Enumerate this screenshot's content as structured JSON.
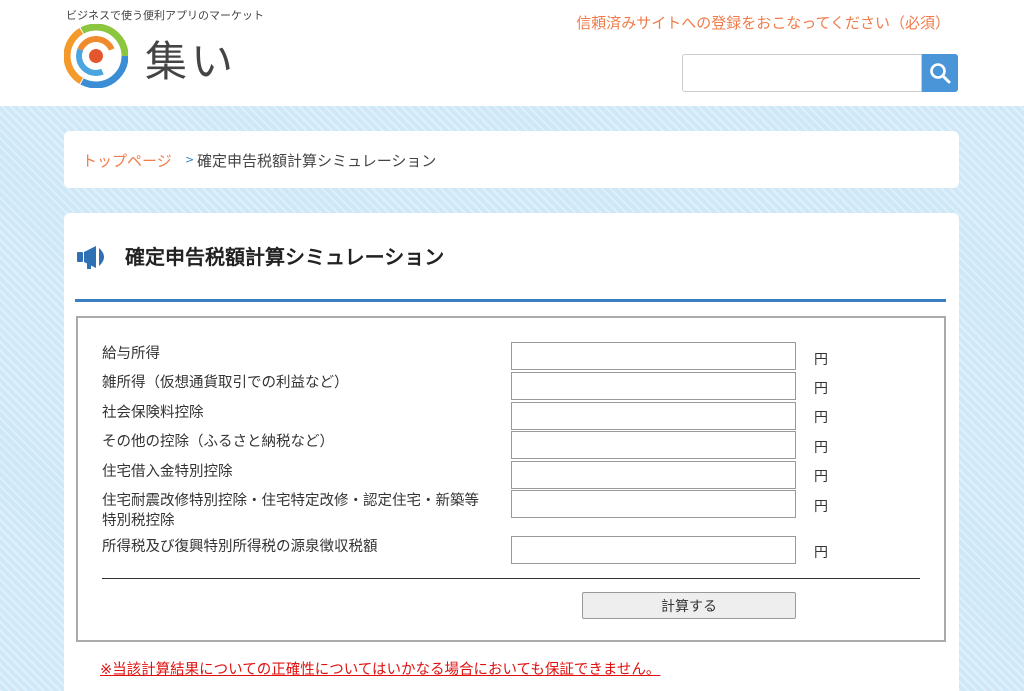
{
  "header": {
    "tagline": "ビジネスで使う便利アプリのマーケット",
    "logo_text": "集い",
    "notice_link": "信頼済みサイトへの登録をおこなってください（必須）",
    "search": {
      "value": "",
      "placeholder": ""
    }
  },
  "breadcrumb": {
    "home": "トップページ",
    "separator": ">",
    "current": "確定申告税額計算シミュレーション"
  },
  "main": {
    "title": "確定申告税額計算シミュレーション",
    "form": {
      "rows": [
        {
          "label": "給与所得",
          "value": "",
          "unit": "円"
        },
        {
          "label": "雑所得（仮想通貨取引での利益など）",
          "value": "",
          "unit": "円"
        },
        {
          "label": "社会保険料控除",
          "value": "",
          "unit": "円"
        },
        {
          "label": "その他の控除（ふるさと納税など）",
          "value": "",
          "unit": "円"
        },
        {
          "label": "住宅借入金特別控除",
          "value": "",
          "unit": "円"
        },
        {
          "label": "住宅耐震改修特別控除・住宅特定改修・認定住宅・新築等特別税控除",
          "value": "",
          "unit": "円"
        },
        {
          "label": "所得税及び復興特別所得税の源泉徴収税額",
          "value": "",
          "unit": "円"
        }
      ],
      "submit_label": "計算する"
    },
    "warning": "※当該計算結果についての正確性についてはいかなる場合においても保証できません。"
  },
  "colors": {
    "accent_orange": "#ef7c4b",
    "accent_blue": "#3a7fc1",
    "warning_red": "#e01010",
    "background": "#cfe8f8"
  }
}
